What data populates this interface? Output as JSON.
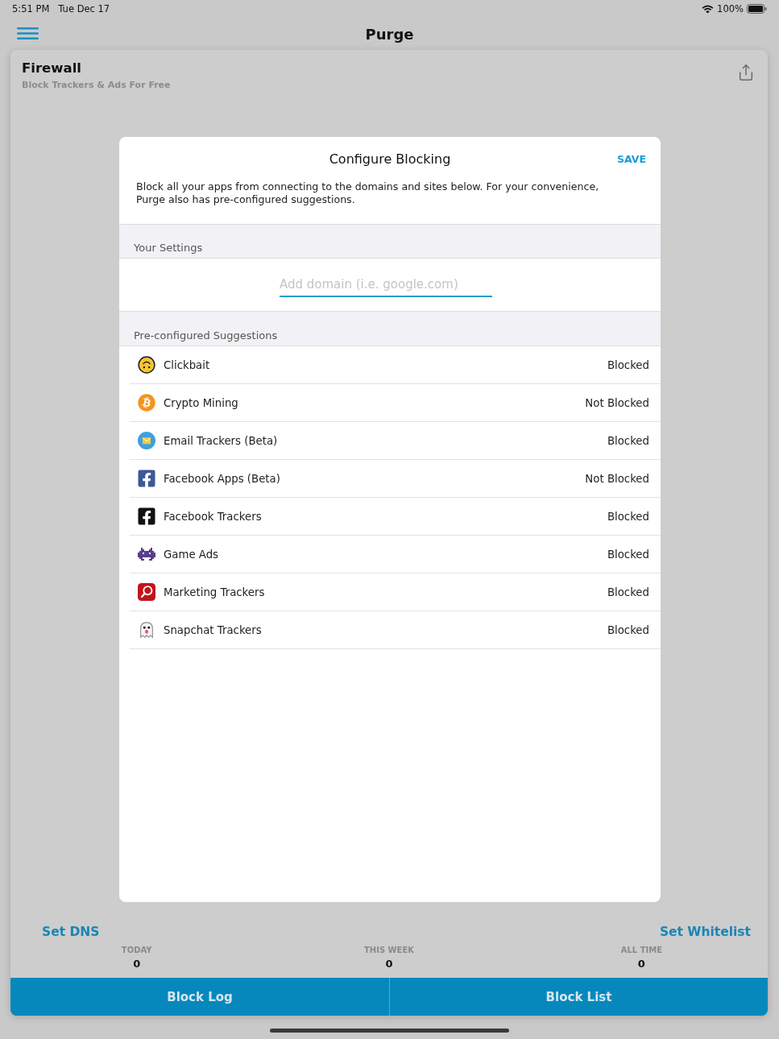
{
  "status_bar": {
    "time": "5:51 PM",
    "date": "Tue Dec 17",
    "battery": "100%"
  },
  "nav_bar": {
    "title": "Purge"
  },
  "card": {
    "title": "Firewall",
    "subtitle": "Block Trackers & Ads For Free",
    "links": [
      "Set DNS",
      "Set Whitelist"
    ],
    "stats": [
      {
        "label": "TODAY",
        "value": "0"
      },
      {
        "label": "THIS WEEK",
        "value": "0"
      },
      {
        "label": "ALL TIME",
        "value": "0"
      }
    ],
    "buttons": [
      "Block Log",
      "Block List"
    ]
  },
  "dialog": {
    "title": "Configure Blocking",
    "action": "SAVE",
    "description": "Block all your apps from connecting to the domains and sites below. For your convenience, Purge also has pre-configured suggestions.",
    "settings_section": {
      "heading": "Your Settings",
      "domain_field": {
        "placeholder": "Add domain (i.e. google.com)"
      }
    },
    "suggestions_section": {
      "heading": "Pre-configured Suggestions",
      "items": [
        {
          "name": "Clickbait",
          "status": "Blocked"
        },
        {
          "name": "Crypto Mining",
          "status": "Not Blocked"
        },
        {
          "name": "Email Trackers (Beta)",
          "status": "Blocked"
        },
        {
          "name": "Facebook Apps (Beta)",
          "status": "Not Blocked"
        },
        {
          "name": "Facebook Trackers",
          "status": "Blocked"
        },
        {
          "name": "Game Ads",
          "status": "Blocked"
        },
        {
          "name": "Marketing Trackers",
          "status": "Blocked"
        },
        {
          "name": "Snapchat Trackers",
          "status": "Blocked"
        }
      ]
    }
  }
}
